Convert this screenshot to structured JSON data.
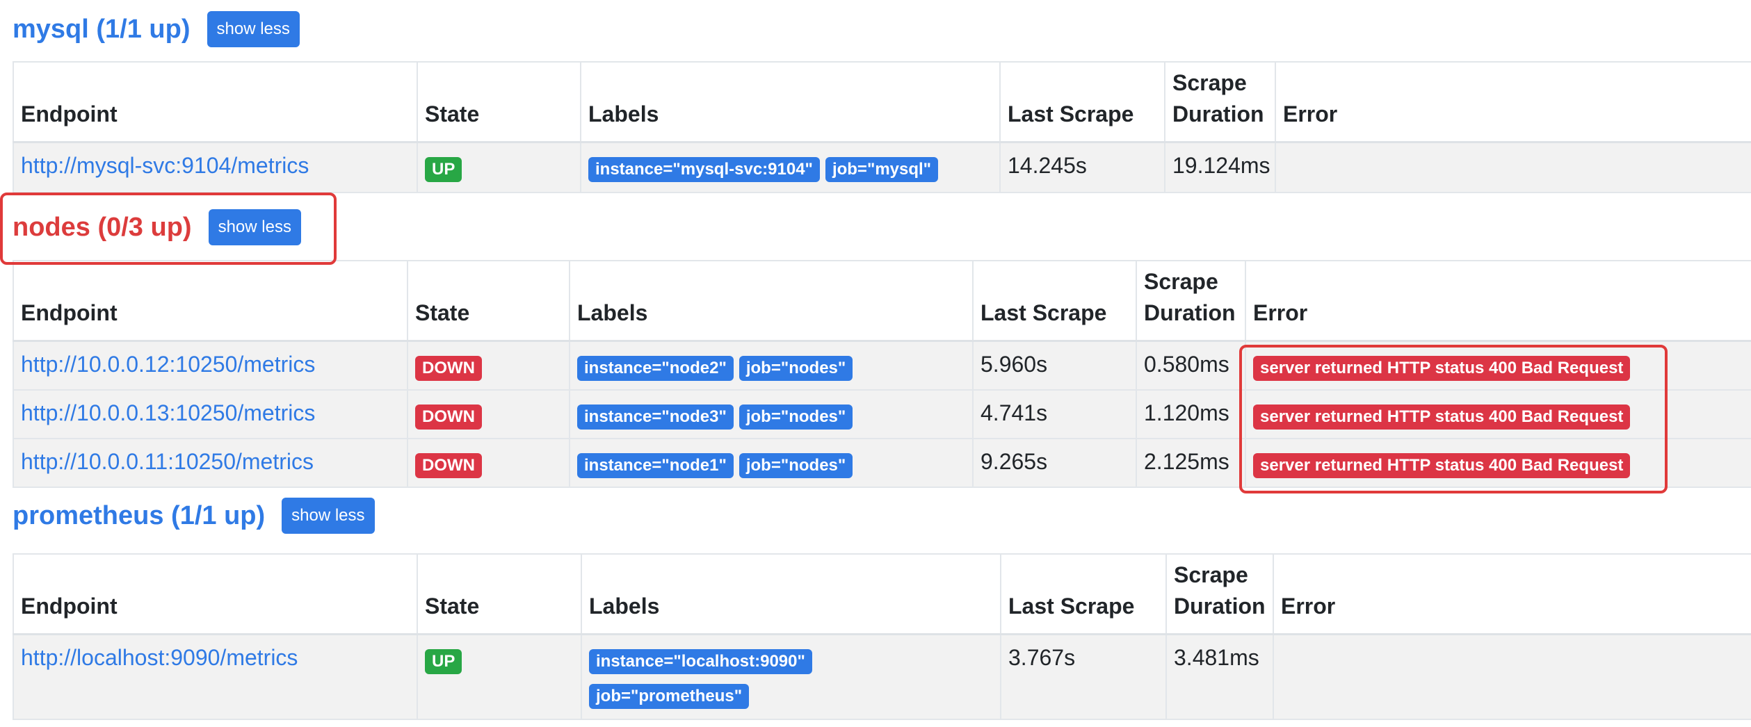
{
  "columns": {
    "endpoint": "Endpoint",
    "state": "State",
    "labels": "Labels",
    "last_scrape": "Last Scrape",
    "scrape_duration_line1": "Scrape",
    "scrape_duration_line2": "Duration",
    "error": "Error"
  },
  "sections": [
    {
      "title": "mysql (1/1 up)",
      "button": "show less",
      "rows": [
        {
          "endpoint": "http://mysql-svc:9104/metrics",
          "state": "UP",
          "labels": [
            "instance=\"mysql-svc:9104\"",
            "job=\"mysql\""
          ],
          "last_scrape": "14.245s",
          "duration": "19.124ms",
          "error": ""
        }
      ]
    },
    {
      "title": "nodes (0/3 up)",
      "button": "show less",
      "rows": [
        {
          "endpoint": "http://10.0.0.12:10250/metrics",
          "state": "DOWN",
          "labels": [
            "instance=\"node2\"",
            "job=\"nodes\""
          ],
          "last_scrape": "5.960s",
          "duration": "0.580ms",
          "error": "server returned HTTP status 400 Bad Request"
        },
        {
          "endpoint": "http://10.0.0.13:10250/metrics",
          "state": "DOWN",
          "labels": [
            "instance=\"node3\"",
            "job=\"nodes\""
          ],
          "last_scrape": "4.741s",
          "duration": "1.120ms",
          "error": "server returned HTTP status 400 Bad Request"
        },
        {
          "endpoint": "http://10.0.0.11:10250/metrics",
          "state": "DOWN",
          "labels": [
            "instance=\"node1\"",
            "job=\"nodes\""
          ],
          "last_scrape": "9.265s",
          "duration": "2.125ms",
          "error": "server returned HTTP status 400 Bad Request"
        }
      ]
    },
    {
      "title": "prometheus (1/1 up)",
      "button": "show less",
      "rows": [
        {
          "endpoint": "http://localhost:9090/metrics",
          "state": "UP",
          "labels": [
            "instance=\"localhost:9090\"",
            "job=\"prometheus\""
          ],
          "last_scrape": "3.767s",
          "duration": "3.481ms",
          "error": ""
        }
      ]
    }
  ],
  "colors": {
    "accent": "#2f7ae5",
    "up": "#28a745",
    "down": "#dc3545",
    "highlight": "#e03a3a"
  }
}
